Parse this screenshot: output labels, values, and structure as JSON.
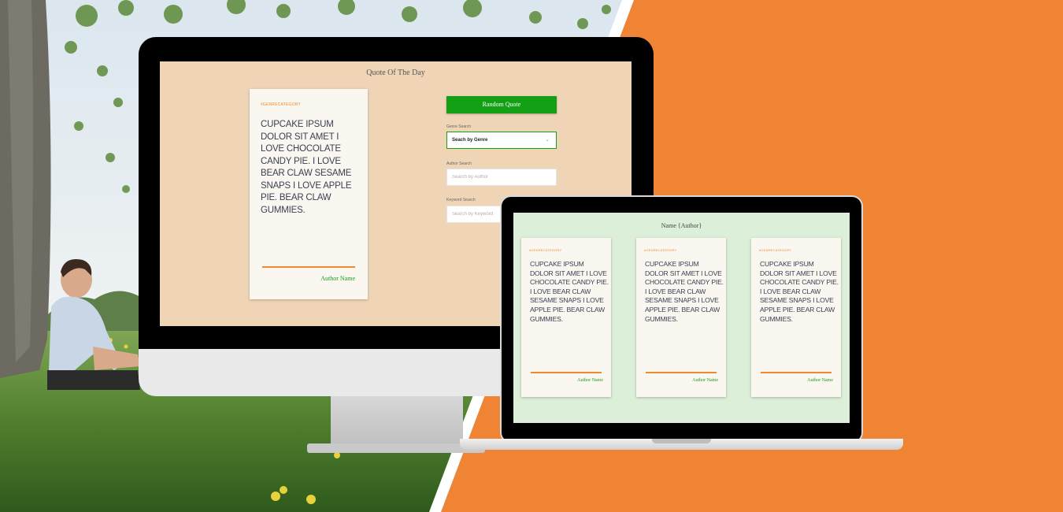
{
  "desktop": {
    "title": "Quote Of The Day",
    "card": {
      "category": "#GENRECATEGORY",
      "text": "Cupcake ipsum dolor sit amet I love chocolate candy pie. I love bear claw sesame snaps I love apple pie. Bear claw gummies.",
      "author": "Author Name"
    },
    "random_button": "Random Quote",
    "genre_label": "Genre Search",
    "genre_value": "Seach by Genre",
    "author_label": "Author Search",
    "author_placeholder": "Search by Author",
    "keyword_label": "Keyword Search",
    "keyword_placeholder": "Search by Keyword"
  },
  "laptop": {
    "title": "Name {Author}",
    "cards": [
      {
        "category": "#GENRECATEGORY",
        "text": "Cupcake ipsum dolor sit amet I love chocolate candy pie. I love bear claw sesame snaps I love apple pie. Bear claw gummies.",
        "author": "Author Name"
      },
      {
        "category": "#GENRECATEGORY",
        "text": "Cupcake ipsum dolor sit amet I love chocolate candy pie. I love bear claw sesame snaps I love apple pie. Bear claw gummies.",
        "author": "Author Name"
      },
      {
        "category": "#GENRECATEGORY",
        "text": "Cupcake ipsum dolor sit amet I love chocolate candy pie. I love bear claw sesame snaps I love apple pie. Bear claw gummies.",
        "author": "Author Name"
      }
    ]
  },
  "colors": {
    "orange_background": "#ef8434",
    "desktop_screen": "#efd5b6",
    "laptop_screen": "#dcefd8",
    "accent_green": "#14a014",
    "accent_orange": "#ef8a2e",
    "card_text": "#3a3f52"
  }
}
